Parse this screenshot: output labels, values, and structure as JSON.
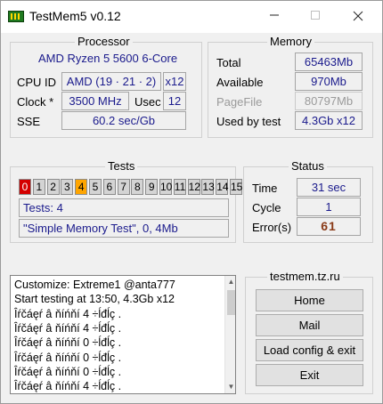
{
  "window": {
    "title": "TestMem5 v0.12"
  },
  "processor": {
    "legend": "Processor",
    "name": "AMD Ryzen 5 5600 6-Core",
    "cpu_id_label": "CPU ID",
    "cpu_id_value": "AMD (19 · 21 · 2)",
    "cpu_threads": "x12",
    "clock_label": "Clock *",
    "clock_value": "3500 MHz",
    "usec_label": "Usec",
    "usec_value": "12",
    "sse_label": "SSE",
    "sse_value": "60.2 sec/Gb"
  },
  "memory": {
    "legend": "Memory",
    "total_label": "Total",
    "total_value": "65463Mb",
    "available_label": "Available",
    "available_value": "970Mb",
    "pagefile_label": "PageFile",
    "pagefile_value": "80797Mb",
    "used_label": "Used by test",
    "used_value": "4.3Gb x12"
  },
  "tests": {
    "legend": "Tests",
    "cells": [
      {
        "label": "0",
        "state": "red"
      },
      {
        "label": "1",
        "state": "idle"
      },
      {
        "label": "2",
        "state": "idle"
      },
      {
        "label": "3",
        "state": "idle"
      },
      {
        "label": "4",
        "state": "orange"
      },
      {
        "label": "5",
        "state": "idle"
      },
      {
        "label": "6",
        "state": "idle"
      },
      {
        "label": "7",
        "state": "idle"
      },
      {
        "label": "8",
        "state": "idle"
      },
      {
        "label": "9",
        "state": "idle"
      },
      {
        "label": "10",
        "state": "idle"
      },
      {
        "label": "11",
        "state": "idle"
      },
      {
        "label": "12",
        "state": "idle"
      },
      {
        "label": "13",
        "state": "idle"
      },
      {
        "label": "14",
        "state": "idle"
      },
      {
        "label": "15",
        "state": "idle"
      }
    ],
    "current_test": "Tests: 4",
    "description": "\"Simple Memory Test\", 0, 4Mb"
  },
  "status": {
    "legend": "Status",
    "time_label": "Time",
    "time_value": "31 sec",
    "cycle_label": "Cycle",
    "cycle_value": "1",
    "errors_label": "Error(s)",
    "errors_value": "61"
  },
  "log": {
    "lines": [
      "Customize: Extreme1 @anta777",
      "Start testing at 13:50, 4.3Gb x12",
      "Îŕčáęŕ â ňíńňí 4 ÷ĺđĺç .",
      "Îŕčáęŕ â ňíńňí 4 ÷ĺđĺç .",
      "Îŕčáęŕ â ňíńňí 0 ÷ĺđĺç .",
      "Îŕčáęŕ â ňíńňí 0 ÷ĺđĺç .",
      "Îŕčáęŕ â ňíńňí 0 ÷ĺđĺç .",
      "Îŕčáęŕ â ňíńňí 4 ÷ĺđĺç ."
    ]
  },
  "links": {
    "legend": "testmem.tz.ru",
    "home": "Home",
    "mail": "Mail",
    "load_config": "Load config & exit",
    "exit": "Exit"
  }
}
